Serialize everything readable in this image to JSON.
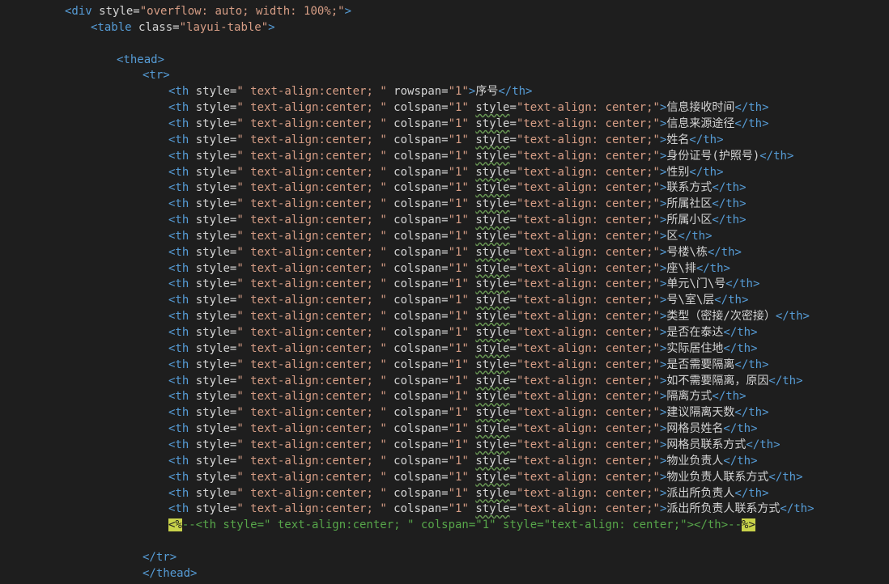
{
  "editor": {
    "lines": [
      {
        "indent": 0,
        "kind": "open",
        "text": "<div style=\"overflow: auto; width: 100%;\">"
      },
      {
        "indent": 1,
        "kind": "open",
        "text": "<table class=\"layui-table\">"
      },
      {
        "indent": 0,
        "kind": "blank",
        "text": ""
      },
      {
        "indent": 2,
        "kind": "open",
        "text": "<thead>"
      },
      {
        "indent": 3,
        "kind": "open",
        "text": "<tr>"
      },
      {
        "indent": 4,
        "kind": "th-rowspan",
        "label": "序号"
      },
      {
        "indent": 4,
        "kind": "th",
        "label": "信息接收时间"
      },
      {
        "indent": 4,
        "kind": "th",
        "label": "信息来源途径"
      },
      {
        "indent": 4,
        "kind": "th",
        "label": "姓名"
      },
      {
        "indent": 4,
        "kind": "th",
        "label": "身份证号(护照号)"
      },
      {
        "indent": 4,
        "kind": "th",
        "label": "性别"
      },
      {
        "indent": 4,
        "kind": "th",
        "label": "联系方式"
      },
      {
        "indent": 4,
        "kind": "th",
        "label": "所属社区"
      },
      {
        "indent": 4,
        "kind": "th",
        "label": "所属小区"
      },
      {
        "indent": 4,
        "kind": "th",
        "label": "区"
      },
      {
        "indent": 4,
        "kind": "th",
        "label": "号楼\\栋"
      },
      {
        "indent": 4,
        "kind": "th",
        "label": "座\\排"
      },
      {
        "indent": 4,
        "kind": "th",
        "label": "单元\\门\\号"
      },
      {
        "indent": 4,
        "kind": "th",
        "label": "号\\室\\层"
      },
      {
        "indent": 4,
        "kind": "th",
        "label": "类型（密接/次密接）"
      },
      {
        "indent": 4,
        "kind": "th",
        "label": "是否在泰达"
      },
      {
        "indent": 4,
        "kind": "th",
        "label": "实际居住地"
      },
      {
        "indent": 4,
        "kind": "th",
        "label": "是否需要隔离"
      },
      {
        "indent": 4,
        "kind": "th",
        "label": "如不需要隔离，原因"
      },
      {
        "indent": 4,
        "kind": "th",
        "label": "隔离方式"
      },
      {
        "indent": 4,
        "kind": "th",
        "label": "建议隔离天数"
      },
      {
        "indent": 4,
        "kind": "th",
        "label": "网格员姓名"
      },
      {
        "indent": 4,
        "kind": "th",
        "label": "网格员联系方式"
      },
      {
        "indent": 4,
        "kind": "th",
        "label": "物业负责人"
      },
      {
        "indent": 4,
        "kind": "th",
        "label": "物业负责人联系方式"
      },
      {
        "indent": 4,
        "kind": "th",
        "label": "派出所负责人"
      },
      {
        "indent": 4,
        "kind": "th",
        "label": "派出所负责人联系方式"
      },
      {
        "indent": 4,
        "kind": "comment",
        "open": "<%",
        "body": "--<th style=\" text-align:center; \" colspan=\"1\" style=\"text-align: center;\"></th>--",
        "close": "%>"
      },
      {
        "indent": 0,
        "kind": "blank",
        "text": ""
      },
      {
        "indent": 3,
        "kind": "close",
        "text": "</tr>"
      },
      {
        "indent": 3,
        "kind": "close",
        "text": "</thead>"
      }
    ]
  },
  "colors": {
    "background": "#1e1e1e",
    "tag": "#569cd6",
    "string": "#d69d85",
    "text": "#d4d4d4",
    "comment": "#57a64a",
    "marker": "#c9d34a"
  }
}
